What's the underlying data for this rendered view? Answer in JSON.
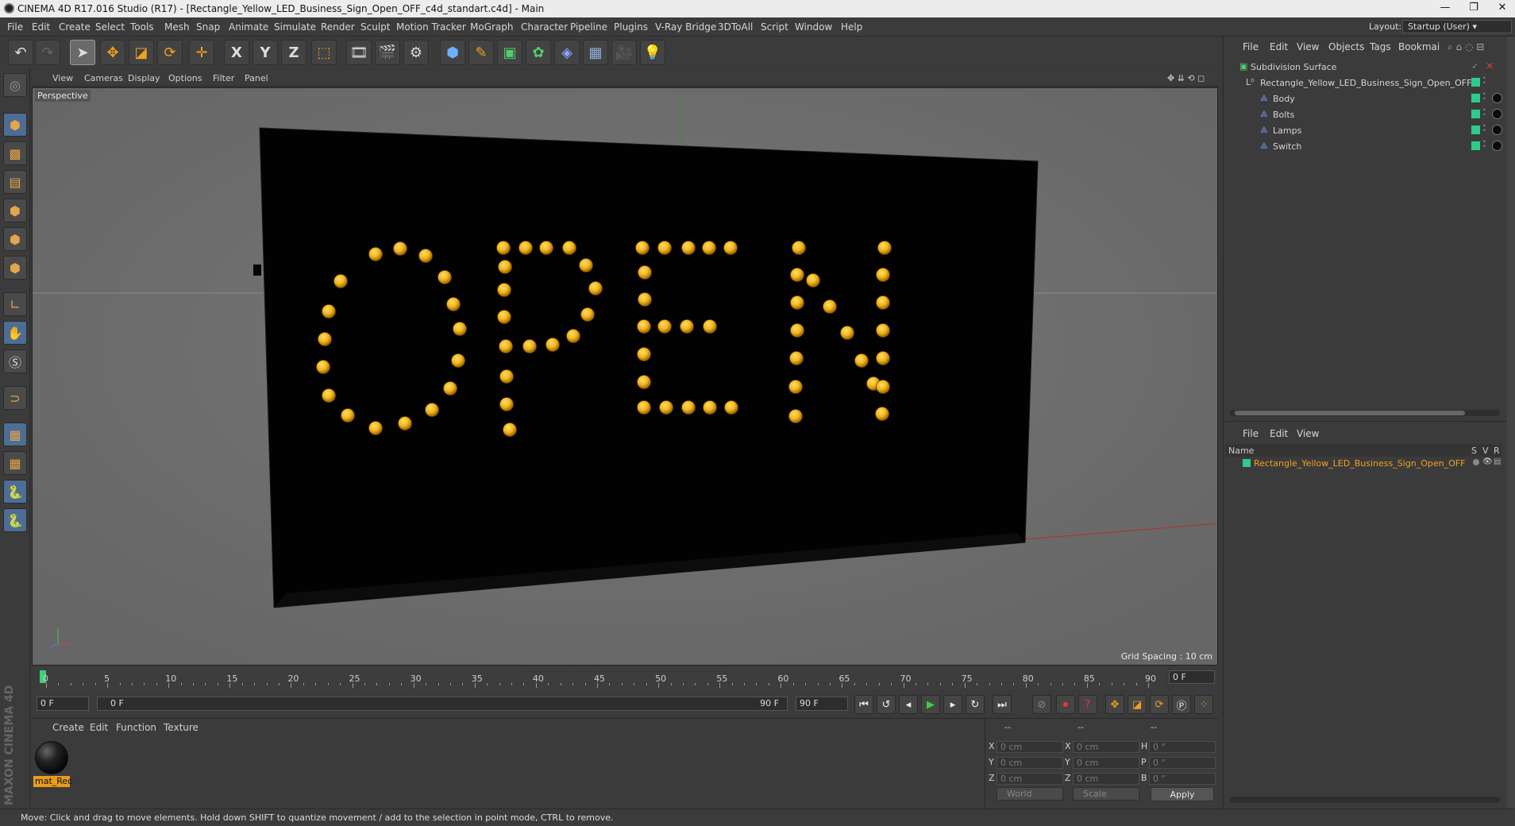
{
  "window": {
    "title": "CINEMA 4D R17.016 Studio (R17) - [Rectangle_Yellow_LED_Business_Sign_Open_OFF_c4d_standart.c4d] - Main"
  },
  "menubar": {
    "items": [
      "File",
      "Edit",
      "Create",
      "Select",
      "Tools",
      "Mesh",
      "Snap",
      "Animate",
      "Simulate",
      "Render",
      "Sculpt",
      "Motion Tracker",
      "MoGraph",
      "Character",
      "Pipeline",
      "Plugins",
      "V-Ray Bridge",
      "3DToAll",
      "Script",
      "Window",
      "Help"
    ],
    "layout_label": "Layout:",
    "layout_value": "Startup (User)"
  },
  "toolbar": {
    "icons": [
      "undo-icon",
      "redo-icon",
      "select-arrow-icon",
      "move-icon",
      "scale-icon",
      "rotate-icon",
      "move-plus-icon",
      "x-axis-icon",
      "y-axis-icon",
      "z-axis-icon",
      "coordinate-system-icon",
      "render-view-icon",
      "render-picture-viewer-icon",
      "render-settings-icon",
      "cube-icon",
      "pen-icon",
      "subdivision-icon",
      "array-icon",
      "deformer-icon",
      "floor-icon",
      "camera-icon",
      "light-icon"
    ],
    "axis_labels": [
      "X",
      "Y",
      "Z"
    ]
  },
  "viewport": {
    "menu": [
      "View",
      "Cameras",
      "Display",
      "Options",
      "Filter",
      "Panel"
    ],
    "camera_label": "Perspective",
    "grid_spacing": "Grid Spacing : 10 cm",
    "sign_text": "OPEN"
  },
  "timeline": {
    "ticks": [
      "0",
      "5",
      "10",
      "15",
      "20",
      "25",
      "30",
      "35",
      "40",
      "45",
      "50",
      "55",
      "60",
      "65",
      "70",
      "75",
      "80",
      "85",
      "90"
    ],
    "current_frame": "0 F"
  },
  "transport": {
    "start_field": "0 F",
    "range_start": "0 F",
    "range_end": "90 F",
    "end_field": "90 F"
  },
  "material_manager": {
    "menu": [
      "Create",
      "Edit",
      "Function",
      "Texture"
    ],
    "material_name": "mat_Rec"
  },
  "coordinates": {
    "header": [
      "--",
      "--",
      "--"
    ],
    "position": {
      "x_label": "X",
      "y_label": "Y",
      "z_label": "Z",
      "x": "0 cm",
      "y": "0 cm",
      "z": "0 cm"
    },
    "size": {
      "x_label": "X",
      "y_label": "Y",
      "z_label": "Z",
      "x": "0 cm",
      "y": "0 cm",
      "z": "0 cm"
    },
    "rotation": {
      "h_label": "H",
      "p_label": "P",
      "b_label": "B",
      "h": "0 °",
      "p": "0 °",
      "b": "0 °"
    },
    "mode_world": "World",
    "mode_scale": "Scale",
    "apply_label": "Apply"
  },
  "object_manager": {
    "menu": [
      "File",
      "Edit",
      "View",
      "Objects",
      "Tags",
      "Bookmai"
    ],
    "objects": [
      {
        "name": "Subdivision Surface",
        "indent": 0
      },
      {
        "name": "Rectangle_Yellow_LED_Business_Sign_Open_OFF",
        "indent": 1
      },
      {
        "name": "Body",
        "indent": 2
      },
      {
        "name": "Bolts",
        "indent": 2
      },
      {
        "name": "Lamps",
        "indent": 2
      },
      {
        "name": "Switch",
        "indent": 2
      }
    ]
  },
  "attribute_manager": {
    "menu": [
      "File",
      "Edit",
      "View"
    ],
    "columns": {
      "name": "Name",
      "s": "S",
      "v": "V",
      "r": "R"
    },
    "row_name": "Rectangle_Yellow_LED_Business_Sign_Open_OFF"
  },
  "status": {
    "text": "Move: Click and drag to move elements. Hold down SHIFT to quantize movement / add to the selection in point mode, CTRL to remove."
  },
  "brand": {
    "vertical_text": "MAXON CINEMA 4D"
  },
  "colors": {
    "accent_orange": "#e89c1a",
    "led_yellow": "#f2b41c",
    "tag_green": "#2ecc8a",
    "sign_black": "#020202"
  }
}
